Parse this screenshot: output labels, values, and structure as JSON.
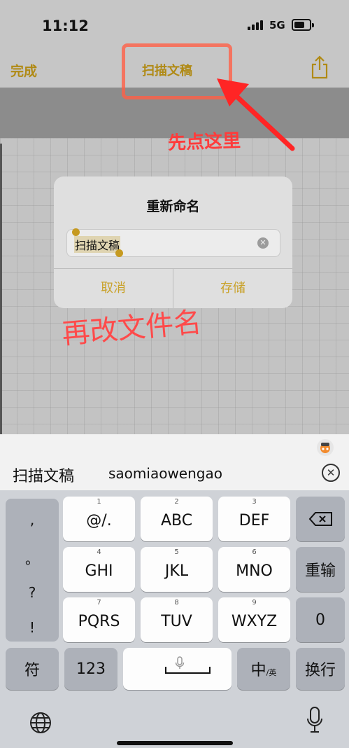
{
  "status": {
    "time": "11:12",
    "network": "5G"
  },
  "nav": {
    "done": "完成",
    "title": "扫描文稿"
  },
  "dialog": {
    "title": "重新命名",
    "input_value": "扫描文稿",
    "cancel": "取消",
    "save": "存储"
  },
  "annotations": {
    "first": "先点这里",
    "second": "再改文件名"
  },
  "keyboard": {
    "candidate_1": "扫描文稿",
    "candidate_2": "saomiaowengao",
    "punct": [
      ",",
      "。",
      "?",
      "!"
    ],
    "keys": [
      {
        "num": "1",
        "label": "@/."
      },
      {
        "num": "2",
        "label": "ABC"
      },
      {
        "num": "3",
        "label": "DEF"
      },
      {
        "num": "4",
        "label": "GHI"
      },
      {
        "num": "5",
        "label": "JKL"
      },
      {
        "num": "6",
        "label": "MNO"
      },
      {
        "num": "7",
        "label": "PQRS"
      },
      {
        "num": "8",
        "label": "TUV"
      },
      {
        "num": "9",
        "label": "WXYZ"
      }
    ],
    "reinput": "重输",
    "zero": "0",
    "symbol": "符",
    "num123": "123",
    "lang_main": "中",
    "lang_sub": "/英",
    "newline": "换行"
  },
  "colors": {
    "accent": "#c9a22a",
    "annotation": "#ff3b3b"
  }
}
